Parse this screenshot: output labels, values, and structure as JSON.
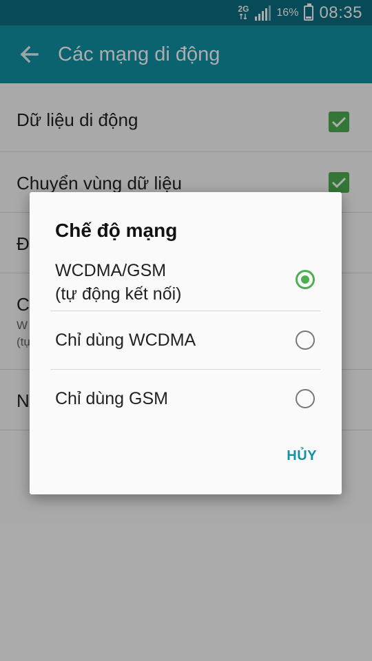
{
  "status_bar": {
    "network": "2G",
    "battery_percent": "16%",
    "time": "08:35"
  },
  "app_bar": {
    "title": "Các mạng di động",
    "back_icon": "arrow-left-icon"
  },
  "settings": [
    {
      "label": "Dữ liệu di động",
      "checked": true
    },
    {
      "label": "Chuyển vùng dữ liệu",
      "checked": true
    },
    {
      "label": "Đ"
    },
    {
      "label": "C",
      "sub": [
        "W",
        "(tự"
      ]
    },
    {
      "label": "N"
    }
  ],
  "dialog": {
    "title": "Chế độ mạng",
    "options": [
      {
        "label_line1": "WCDMA/GSM",
        "label_line2": "(tự động kết nối)",
        "selected": true
      },
      {
        "label_line1": "Chỉ dùng WCDMA",
        "selected": false
      },
      {
        "label_line1": "Chỉ dùng GSM",
        "selected": false
      }
    ],
    "cancel_label": "HỦY"
  },
  "colors": {
    "status_bar": "#0a6f80",
    "app_bar": "#1192a6",
    "accent": "#4caf50",
    "button_text": "#1192a6"
  }
}
